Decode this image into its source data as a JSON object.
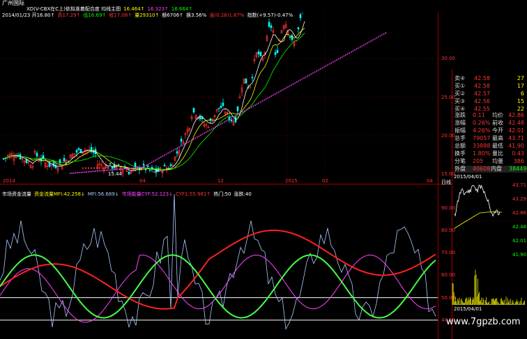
{
  "header": {
    "logo": "广州国际",
    "line1": [
      {
        "text": "XD(V-CBX在C上)依拟准着配合度 均线主图",
        "color": "#ffffff"
      },
      {
        "text": "16.464↑",
        "color": "#ffff00"
      },
      {
        "text": "16.323↑",
        "color": "#ff44ff"
      },
      {
        "text": "16.664↑",
        "color": "#00ff00"
      }
    ],
    "line2": [
      {
        "text": "2014/01/23 开16.80↑",
        "color": "#ffffff"
      },
      {
        "text": "高17.29↑",
        "color": "#ff3333"
      },
      {
        "text": "低16.69↑",
        "color": "#00ff00"
      },
      {
        "text": "收17.08↑",
        "color": "#ff3333"
      },
      {
        "text": "量29310↑",
        "color": "#ffff00"
      },
      {
        "text": "额6706↑",
        "color": "#ffffff"
      },
      {
        "text": "换3.56%",
        "color": "#ffffff"
      },
      {
        "text": "涨(0.28)1.67%",
        "color": "#ff3333"
      },
      {
        "text": "指数(+9.57)-0.47%",
        "color": "#ffffff"
      }
    ]
  },
  "main_chart": {
    "price_axis": [
      "30.00",
      "25.00",
      "20.00",
      "15.00"
    ],
    "price_range": [
      14.5,
      36
    ],
    "time_axis": [
      "2014",
      "04",
      "12",
      "2015",
      "02",
      "04"
    ],
    "low_label": "15.44",
    "right_label": "日线"
  },
  "indicator": {
    "title_parts": [
      {
        "text": "市场资金流量",
        "color": "#ffffff"
      },
      {
        "text": "资金流量MFI:42.258↓",
        "color": "#ffff00"
      },
      {
        "text": "MFI:56.689↓",
        "color": "#aaccff"
      },
      {
        "text": "市场能量CYF:52.123↓",
        "color": "#ff44ff"
      },
      {
        "text": "CYF1:55.981↑",
        "color": "#ff3333"
      },
      {
        "text": "热门:50",
        "color": "#ffffff"
      },
      {
        "text": "涨跌:40",
        "color": "#ffffff"
      }
    ],
    "axis_labels": [
      "90.00",
      "80.00",
      "70.00",
      "60.00",
      "50.00",
      "40.00"
    ],
    "value_range": [
      35,
      97
    ],
    "hlines": [
      50,
      40
    ]
  },
  "order_book": [
    {
      "label": "卖④",
      "price": "42.58",
      "vol": "27"
    },
    {
      "label": "买①",
      "price": "42.58",
      "vol": "17"
    },
    {
      "label": "买②",
      "price": "42.57",
      "vol": "6"
    },
    {
      "label": "买③",
      "price": "42.56",
      "vol": "15"
    },
    {
      "label": "买④",
      "price": "42.55",
      "vol": "22"
    }
  ],
  "quote": [
    {
      "l1": "涨跌",
      "v1": "0.11",
      "l2": "均价",
      "v2": "42.86"
    },
    {
      "l1": "涨幅",
      "v1": "0.26%",
      "l2": "前收",
      "v2": "42.48"
    },
    {
      "l1": "振幅",
      "v1": "4.26%",
      "l2": "今开",
      "v2": "42.01"
    },
    {
      "l1": "总手",
      "v1": "79057",
      "l2": "最高",
      "v2": "43.71"
    },
    {
      "l1": "总额",
      "v1": "33888",
      "l2": "最低",
      "v2": "41.90"
    },
    {
      "l1": "换手",
      "v1": "1.80%",
      "l2": "量比",
      "v2": "0.43"
    },
    {
      "l1": "分笔",
      "v1": "205",
      "l2": "均量",
      "v2": "386"
    }
  ],
  "outer_inner": {
    "out_label": "外盘",
    "out_val": "40608",
    "in_label": "内盘",
    "in_val": "38449"
  },
  "mini": {
    "date": "2015/04/01",
    "axis": [
      "43.71",
      "43.29",
      "42.86",
      "42.48",
      "42.01",
      "41.90"
    ],
    "date2": "2015/04/01"
  },
  "watermark": "www.7gpzb.com",
  "colors": {
    "up": "#ff3333",
    "down": "#00ffff",
    "border": "#a00000",
    "ma1": "#ffffff",
    "ma2": "#ffff00",
    "ma3": "#00ff00",
    "sar": "#ff44ff"
  }
}
